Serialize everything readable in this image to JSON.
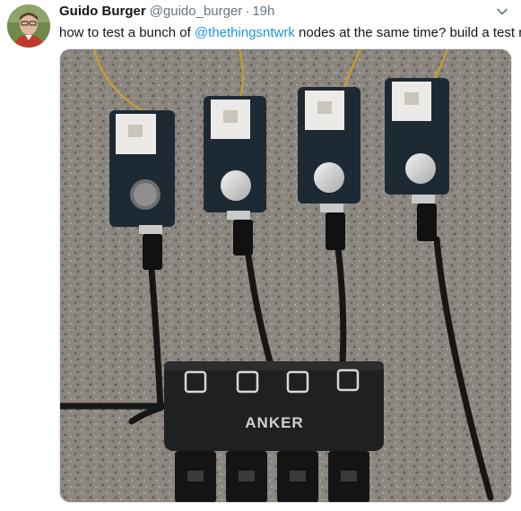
{
  "tweet": {
    "display_name": "Guido Burger",
    "handle": "@guido_burger",
    "separator": "·",
    "timestamp": "19h",
    "text_before": "how to test a bunch of ",
    "mention": "@thethingsntwrk",
    "text_after": " nodes at the same time? build a test rig!"
  },
  "media": {
    "hub_brand": "ANKER",
    "board_count": 4,
    "hub_port_count": 4
  },
  "colors": {
    "mention": "#1b95e0",
    "name": "#14171a",
    "secondary": "#657786"
  },
  "icons": {
    "menu": "chevron-down-icon"
  }
}
